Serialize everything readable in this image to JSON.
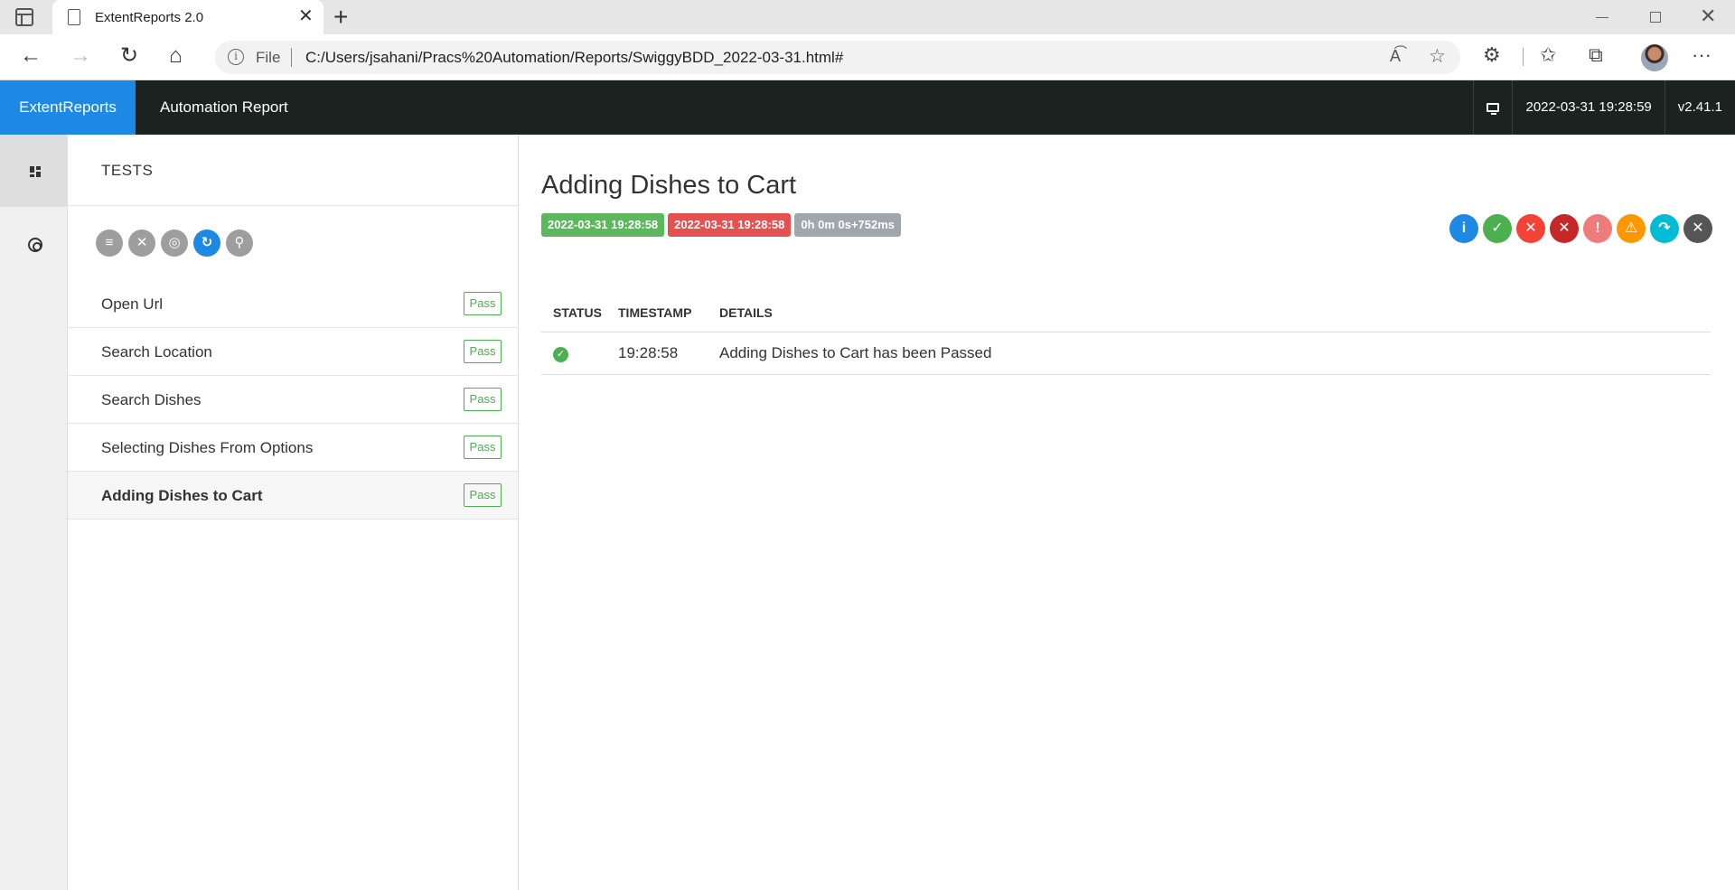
{
  "browser": {
    "tab_title": "ExtentReports 2.0",
    "tab_close": "✕",
    "new_tab": "+",
    "back": "←",
    "forward": "→",
    "reload": "↻",
    "home": "⌂",
    "address_info": "i",
    "address_scheme": "File",
    "address_url": "C:/Users/jsahani/Pracs%20Automation/Reports/SwiggyBDD_2022-03-31.html#",
    "read_aloud": "A͡",
    "add_favorite": "☆",
    "extensions": "⚙",
    "favorites": "✩",
    "collections": "⧉",
    "more": "···",
    "window_close": "✕"
  },
  "header": {
    "brand": "ExtentReports",
    "report_name": "Automation Report",
    "timestamp": "2022-03-31 19:28:59",
    "version": "v2.41.1"
  },
  "tests_panel": {
    "title": "TESTS",
    "tools": [
      {
        "name": "list",
        "glyph": "≡",
        "color": "#9e9e9e"
      },
      {
        "name": "clear",
        "glyph": "✕",
        "color": "#9e9e9e"
      },
      {
        "name": "spiral",
        "glyph": "◎",
        "color": "#9e9e9e"
      },
      {
        "name": "refresh",
        "glyph": "↻",
        "color": "#1e88e5"
      },
      {
        "name": "search",
        "glyph": "⚲",
        "color": "#9e9e9e"
      }
    ],
    "tests": [
      {
        "name": "Open Url",
        "status": "Pass",
        "active": false
      },
      {
        "name": "Search Location",
        "status": "Pass",
        "active": false
      },
      {
        "name": "Search Dishes",
        "status": "Pass",
        "active": false
      },
      {
        "name": "Selecting Dishes From Options",
        "status": "Pass",
        "active": false
      },
      {
        "name": "Adding Dishes to Cart",
        "status": "Pass",
        "active": true
      }
    ]
  },
  "detail": {
    "title": "Adding Dishes to Cart",
    "start_time": "2022-03-31 19:28:58",
    "end_time": "2022-03-31 19:28:58",
    "duration": "0h 0m 0s+752ms",
    "status_filters": [
      {
        "name": "info",
        "glyph": "i",
        "color": "#1e88e5"
      },
      {
        "name": "pass",
        "glyph": "✓",
        "color": "#4caf50"
      },
      {
        "name": "fail",
        "glyph": "✕",
        "color": "#f44336"
      },
      {
        "name": "fatal",
        "glyph": "✕",
        "color": "#c62828"
      },
      {
        "name": "error",
        "glyph": "!",
        "color": "#ef7b7b"
      },
      {
        "name": "warning",
        "glyph": "⚠",
        "color": "#ff9800"
      },
      {
        "name": "skip",
        "glyph": "↷",
        "color": "#00bcd4"
      },
      {
        "name": "clear",
        "glyph": "✕",
        "color": "#555555"
      }
    ],
    "columns": [
      "STATUS",
      "TIMESTAMP",
      "DETAILS"
    ],
    "logs": [
      {
        "status": "pass",
        "timestamp": "19:28:58",
        "details": "Adding Dishes to Cart has been Passed"
      }
    ]
  }
}
